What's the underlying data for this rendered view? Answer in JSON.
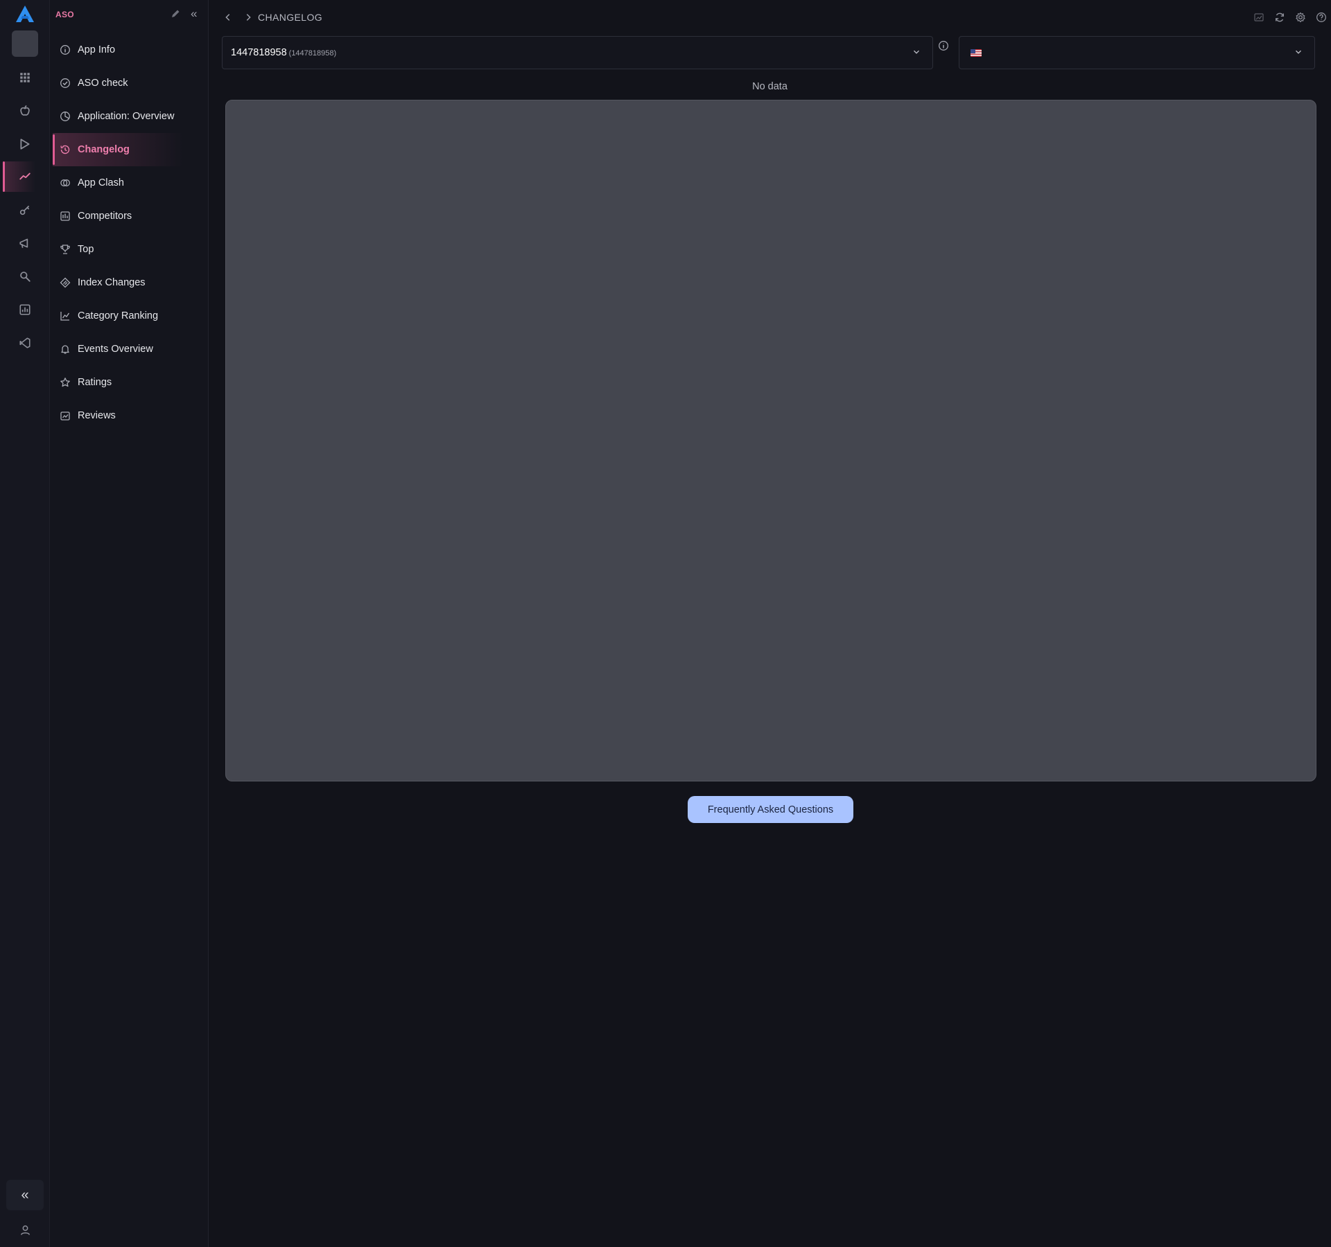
{
  "sidebar": {
    "title": "ASO",
    "items": [
      {
        "label": "App Info",
        "icon": "info-circle-icon"
      },
      {
        "label": "ASO check",
        "icon": "check-circle-icon"
      },
      {
        "label": "Application: Overview",
        "icon": "pie-chart-icon"
      },
      {
        "label": "Changelog",
        "icon": "history-icon",
        "active": true
      },
      {
        "label": "App Clash",
        "icon": "clash-icon"
      },
      {
        "label": "Competitors",
        "icon": "competitors-icon"
      },
      {
        "label": "Top",
        "icon": "trophy-icon"
      },
      {
        "label": "Index Changes",
        "icon": "index-changes-icon"
      },
      {
        "label": "Category Ranking",
        "icon": "line-chart-icon"
      },
      {
        "label": "Events Overview",
        "icon": "bell-icon"
      },
      {
        "label": "Ratings",
        "icon": "star-icon"
      },
      {
        "label": "Reviews",
        "icon": "reviews-icon"
      }
    ]
  },
  "topbar": {
    "breadcrumb": "CHANGELOG"
  },
  "app_select": {
    "value": "1447818958",
    "sub": "(1447818958)"
  },
  "country_select": {
    "flag": "us-flag-icon"
  },
  "main": {
    "empty_text": "No data",
    "faq_label": "Frequently Asked Questions"
  },
  "colors": {
    "accent": "#e05b93",
    "accent_text": "#ef7fad",
    "background": "#12131a",
    "panel": "#44464f",
    "faq_button": "#a9c3ff"
  }
}
